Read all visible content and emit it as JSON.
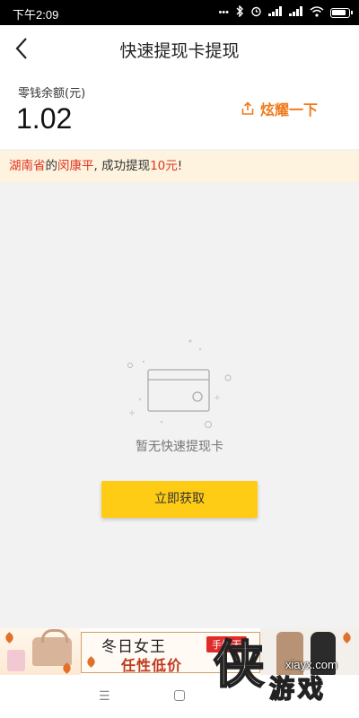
{
  "status_bar": {
    "time": "下午2:09"
  },
  "header": {
    "title": "快速提现卡提现"
  },
  "balance": {
    "label": "零钱余额(元)",
    "amount": "1.02",
    "share_label": "炫耀一下"
  },
  "notice": {
    "province": "湖南省",
    "of1": "的",
    "name": "闵康平",
    "mid": ", 成功提现",
    "amount": "10元",
    "end": "!"
  },
  "empty_state": {
    "text": "暂无快速提现卡",
    "button_label": "立即获取"
  },
  "banner": {
    "title": "冬日女王",
    "subtitle": "任性低价",
    "tag": "手慢无"
  },
  "watermark": {
    "url": "xiayx.com",
    "logo_char": "侠",
    "name": "游戏"
  },
  "colors": {
    "accent_orange": "#f07a1c",
    "notice_red": "#e0341f",
    "button_yellow": "#ffcc15",
    "notice_bg": "#fdf3df"
  }
}
